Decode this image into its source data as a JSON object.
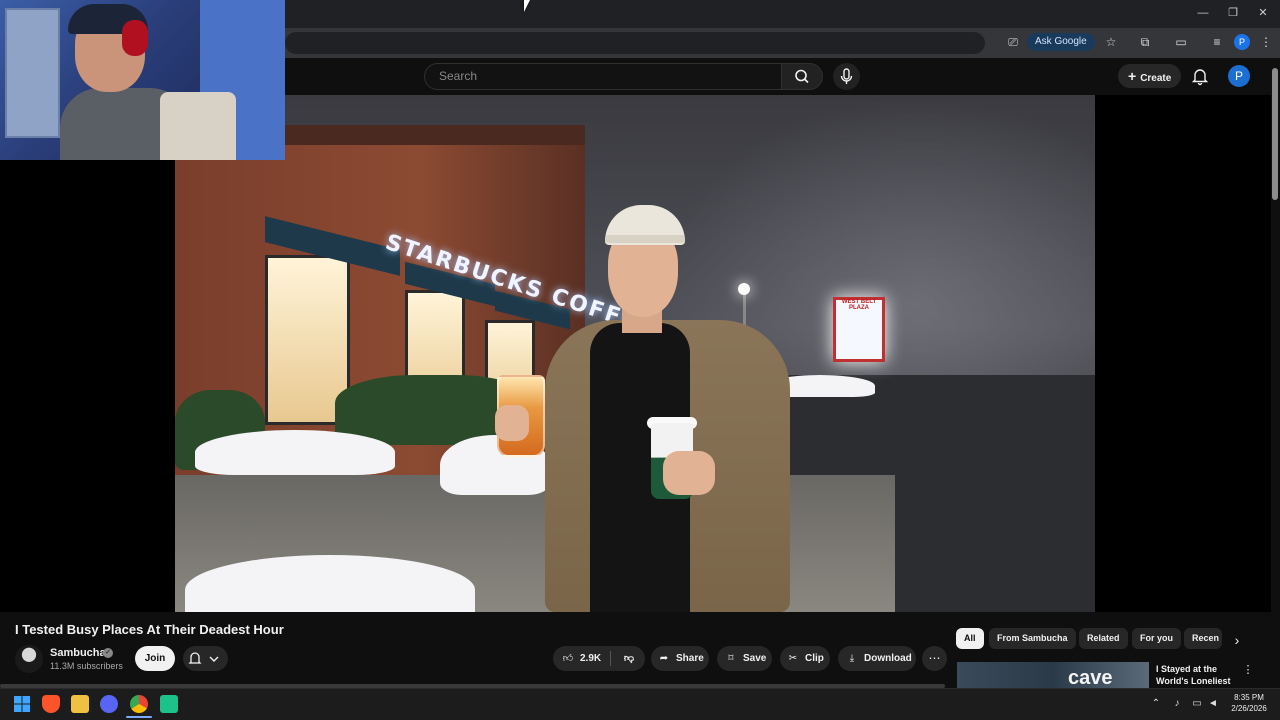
{
  "browser": {
    "ask_google": "Ask Google",
    "profile_initial": "P",
    "window_controls": [
      "—",
      "❐",
      "✕"
    ]
  },
  "youtube": {
    "search_placeholder": "Search",
    "create_label": "Create",
    "avatar_initial": "P"
  },
  "video": {
    "title": "I Tested Busy Places At Their Deadest Hour",
    "sign_text": "STARBUCKS COFFEE",
    "pylon_text": "WEST BELT PLAZA"
  },
  "channel": {
    "name": "Sambucha",
    "subscribers": "11.3M subscribers",
    "join_label": "Join"
  },
  "actions": {
    "likes": "2.9K",
    "share": "Share",
    "save": "Save",
    "clip": "Clip",
    "download": "Download"
  },
  "filter_chips": [
    "All",
    "From Sambucha",
    "Related",
    "For you",
    "Recen"
  ],
  "recommendation": {
    "thumb_text": "cave",
    "title": "I Stayed at the World's Loneliest ..."
  },
  "taskbar": {
    "time": "8:35 PM",
    "date": "2/26/2026"
  }
}
